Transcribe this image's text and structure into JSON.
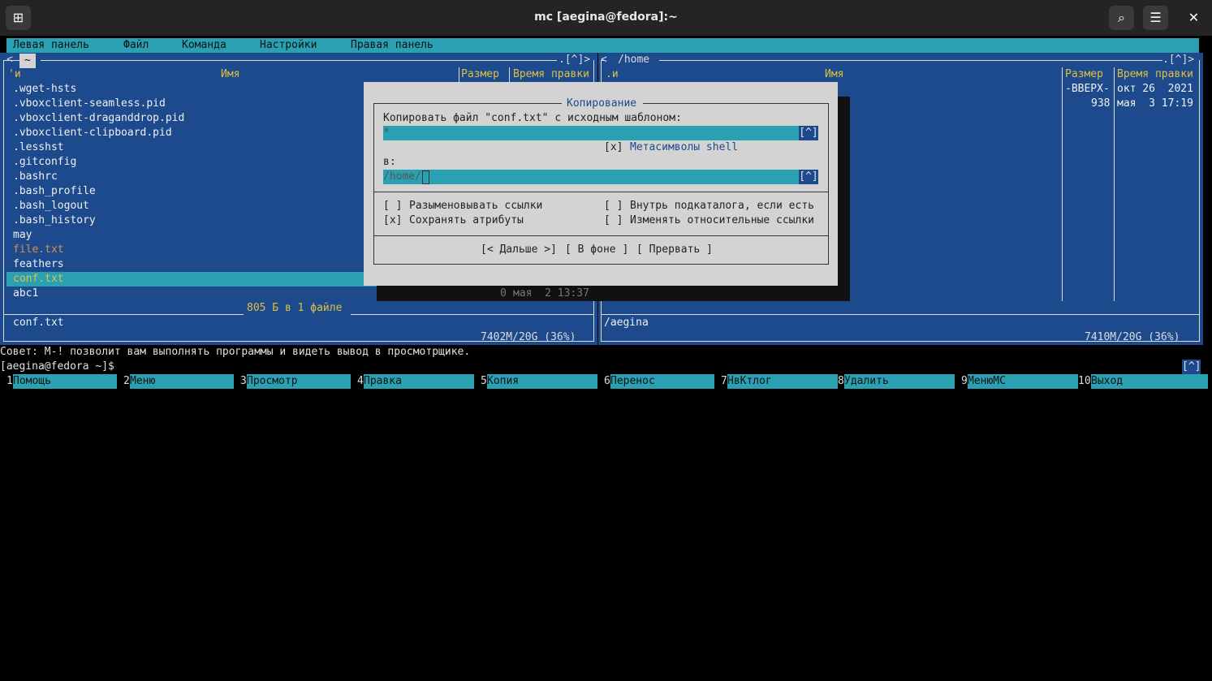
{
  "window": {
    "title": "mc [aegina@fedora]:~",
    "new_tab_icon": "plus-square-icon",
    "search_icon": "search-icon",
    "menu_icon": "hamburger-icon",
    "close_icon": "close-icon"
  },
  "menubar": [
    "Левая панель",
    "Файл",
    "Команда",
    "Настройки",
    "Правая панель"
  ],
  "left_panel": {
    "corner_left": "<",
    "path": "~",
    "corner_right": ".[^]>",
    "col_sort": "'и",
    "col_name": "Имя",
    "col_size": "Размер",
    "col_time": "Время правки",
    "files": [
      {
        "name": ".wget-hsts",
        "color": "white"
      },
      {
        "name": ".vboxclient-seamless.pid",
        "color": "white"
      },
      {
        "name": ".vboxclient-draganddrop.pid",
        "color": "white"
      },
      {
        "name": ".vboxclient-clipboard.pid",
        "color": "white"
      },
      {
        "name": ".lesshst",
        "color": "white"
      },
      {
        "name": ".gitconfig",
        "color": "white"
      },
      {
        "name": ".bashrc",
        "color": "white"
      },
      {
        "name": ".bash_profile",
        "color": "white"
      },
      {
        "name": ".bash_logout",
        "color": "white"
      },
      {
        "name": ".bash_history",
        "color": "white"
      },
      {
        "name": "may",
        "color": "white"
      },
      {
        "name": "file.txt",
        "color": "orange"
      },
      {
        "name": "feathers",
        "color": "white"
      },
      {
        "name": "conf.txt",
        "color": "selected"
      },
      {
        "name": "abc1",
        "color": "white"
      }
    ],
    "last_size": "0",
    "last_time": "мая  2 13:37",
    "summary": "805 Б в 1 файле",
    "mini_status": "conf.txt",
    "disk": "7402M/20G (36%)"
  },
  "right_panel": {
    "corner_left": "<",
    "path": "/home",
    "corner_right": ".[^]>",
    "col_sort": ".и",
    "col_name": "Имя",
    "col_size": "Размер",
    "col_time": "Время правки",
    "rows": [
      {
        "size": "-ВВЕРХ-",
        "time": "окт 26  2021"
      },
      {
        "size": "938",
        "time": "мая  3 17:19"
      }
    ],
    "mini_status": "/aegina",
    "disk": "7410M/20G (36%)"
  },
  "dialog": {
    "title": "Копирование",
    "source_label": "Копировать файл \"conf.txt\" с исходным шаблоном:",
    "source_value": "*",
    "history_btn": "[^]",
    "shell_check": "[x]",
    "shell_label": "Метасимволы shell",
    "dest_label": "в:",
    "dest_value": "/home/",
    "opt1_check": "[ ]",
    "opt1_label": "Разыменовывать ссылки",
    "opt2_check": "[x]",
    "opt2_label": "Сохранять атрибуты",
    "opt3_check": "[ ]",
    "opt3_label": "Внутрь подкаталога, если есть",
    "opt4_check": "[ ]",
    "opt4_label": "Изменять относительные ссылки",
    "btn_next": "[< Дальше >]",
    "btn_bg": "[ В фоне ]",
    "btn_abort": "[ Прервать ]"
  },
  "hint": "Совет: M-! позволит вам выполнять программы и видеть вывод в просмотрщике.",
  "prompt": "[aegina@fedora ~]$",
  "prompt_hist": "[^]",
  "fkeys": [
    {
      "num": "1",
      "label": "Помощь"
    },
    {
      "num": "2",
      "label": "Меню"
    },
    {
      "num": "3",
      "label": "Просмотр"
    },
    {
      "num": "4",
      "label": "Правка"
    },
    {
      "num": "5",
      "label": "Копия"
    },
    {
      "num": "6",
      "label": "Перенос"
    },
    {
      "num": "7",
      "label": "НвКтлог"
    },
    {
      "num": "8",
      "label": "Удалить"
    },
    {
      "num": "9",
      "label": "МенюMC"
    },
    {
      "num": "10",
      "label": "Выход"
    }
  ]
}
